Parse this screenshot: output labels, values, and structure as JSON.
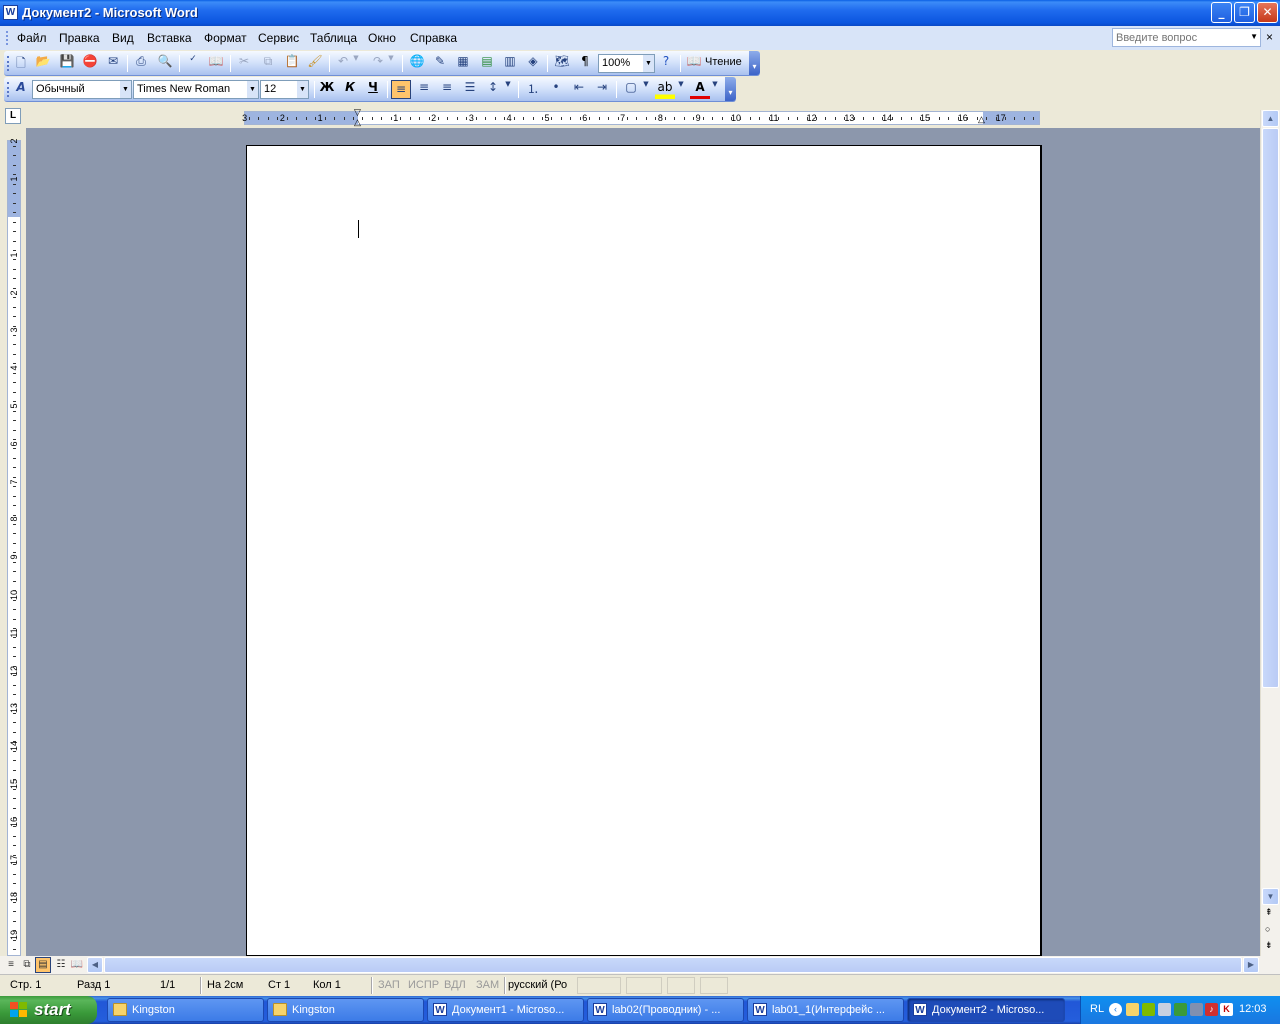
{
  "window": {
    "title": "Документ2 - Microsoft Word",
    "app_icon_letter": "W",
    "buttons": {
      "minimize": "_",
      "restore": "❐",
      "close": "✕"
    }
  },
  "menu": {
    "items": [
      "Файл",
      "Правка",
      "Вид",
      "Вставка",
      "Формат",
      "Сервис",
      "Таблица",
      "Окно",
      "Справка"
    ],
    "help_placeholder": "Введите вопрос",
    "close_doc": "×"
  },
  "standard_toolbar": {
    "zoom": "100%",
    "reading_label": "Чтение",
    "icons": [
      "new-icon",
      "open-icon",
      "save-icon",
      "permission-icon",
      "email-icon",
      "print-icon",
      "print-preview-icon",
      "spelling-icon",
      "research-icon",
      "cut-icon",
      "copy-icon",
      "paste-icon",
      "format-painter-icon",
      "undo-icon",
      "redo-icon",
      "hyperlink-icon",
      "tables-borders-icon",
      "insert-table-icon",
      "insert-excel-icon",
      "columns-icon",
      "drawing-icon",
      "document-map-icon",
      "show-formatting-icon",
      "help-icon",
      "reading-icon"
    ]
  },
  "formatting_toolbar": {
    "style": "Обычный",
    "font": "Times New Roman",
    "size": "12",
    "bold": "Ж",
    "italic": "К",
    "underline": "Ч"
  },
  "ruler": {
    "horizontal_labels": [
      "3",
      "2",
      "1",
      "1",
      "2",
      "3",
      "4",
      "5",
      "6",
      "7",
      "8",
      "9",
      "10",
      "11",
      "12",
      "13",
      "14",
      "15",
      "16",
      "17"
    ],
    "vertical_labels": [
      "2",
      "1",
      "1",
      "2",
      "3",
      "4",
      "5",
      "6",
      "7",
      "8",
      "9",
      "10",
      "11",
      "12",
      "13",
      "14",
      "15",
      "16",
      "17",
      "18",
      "19"
    ],
    "tab_selector": "L"
  },
  "status": {
    "page": "Стр. 1",
    "section": "Разд 1",
    "pages": "1/1",
    "at": "На 2см",
    "line": "Ст 1",
    "col": "Кол 1",
    "rec": "ЗАП",
    "trk": "ИСПР",
    "ext": "ВДЛ",
    "ovr": "ЗАМ",
    "language": "русский (Ро"
  },
  "taskbar": {
    "start": "start",
    "tasks": [
      {
        "label": "Kingston",
        "type": "folder"
      },
      {
        "label": "Kingston",
        "type": "folder"
      },
      {
        "label": "Документ1 - Microso...",
        "type": "word"
      },
      {
        "label": "lab02(Проводник) - ...",
        "type": "word"
      },
      {
        "label": "lab01_1(Интерфейс ...",
        "type": "word"
      },
      {
        "label": "Документ2 - Microso...",
        "type": "word",
        "active": true
      }
    ],
    "lang": "RL",
    "clock": "12:03"
  },
  "colors": {
    "titlebar": "#0A5FE4",
    "workspace": "#8C97AC",
    "taskbar": "#245EDC",
    "start": "#3A9A3A",
    "highlight": "#FFC46B"
  }
}
